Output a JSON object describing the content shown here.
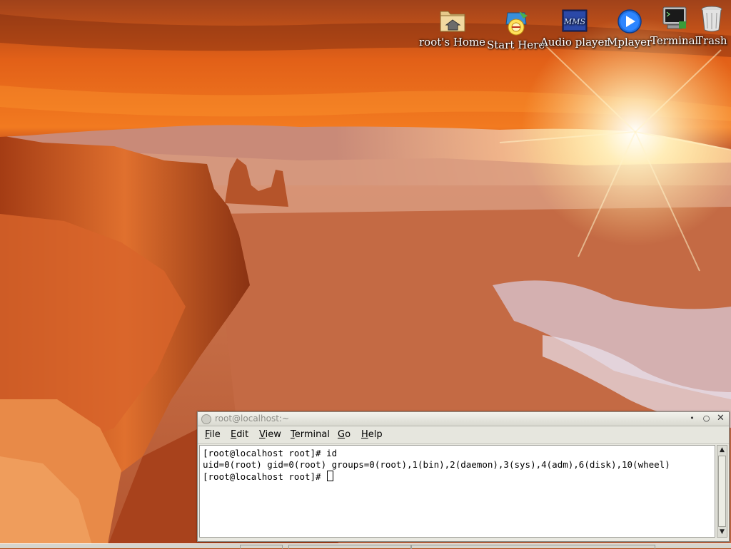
{
  "desktop": {
    "icons": [
      {
        "label": "root's Home",
        "icon": "home-folder-icon"
      },
      {
        "label": "Start Here",
        "icon": "start-here-icon"
      },
      {
        "label": "Audio player",
        "icon": "xmms-icon"
      },
      {
        "label": "Mplayer",
        "icon": "play-icon"
      },
      {
        "label": "Terminal",
        "icon": "terminal-icon"
      },
      {
        "label": "Trash",
        "icon": "trash-icon"
      }
    ]
  },
  "terminal": {
    "title": "root@localhost:~",
    "menu": [
      {
        "accel": "F",
        "rest": "ile"
      },
      {
        "accel": "E",
        "rest": "dit"
      },
      {
        "accel": "V",
        "rest": "iew"
      },
      {
        "accel": "T",
        "rest": "erminal"
      },
      {
        "accel": "G",
        "rest": "o"
      },
      {
        "accel": "H",
        "rest": "elp"
      }
    ],
    "lines": [
      "[root@localhost root]# id",
      "uid=0(root) gid=0(root) groups=0(root),1(bin),2(daemon),3(sys),4(adm),6(disk),10(wheel)",
      "[root@localhost root]# "
    ],
    "buttons": {
      "minimize": "•",
      "maximize": "○",
      "close": "✕"
    }
  },
  "colors": {
    "sky_glow": "#ffe9b0",
    "rock_orange": "#d8561a",
    "rock_dark": "#7a2a10",
    "window_bg": "#e8e8e0"
  }
}
